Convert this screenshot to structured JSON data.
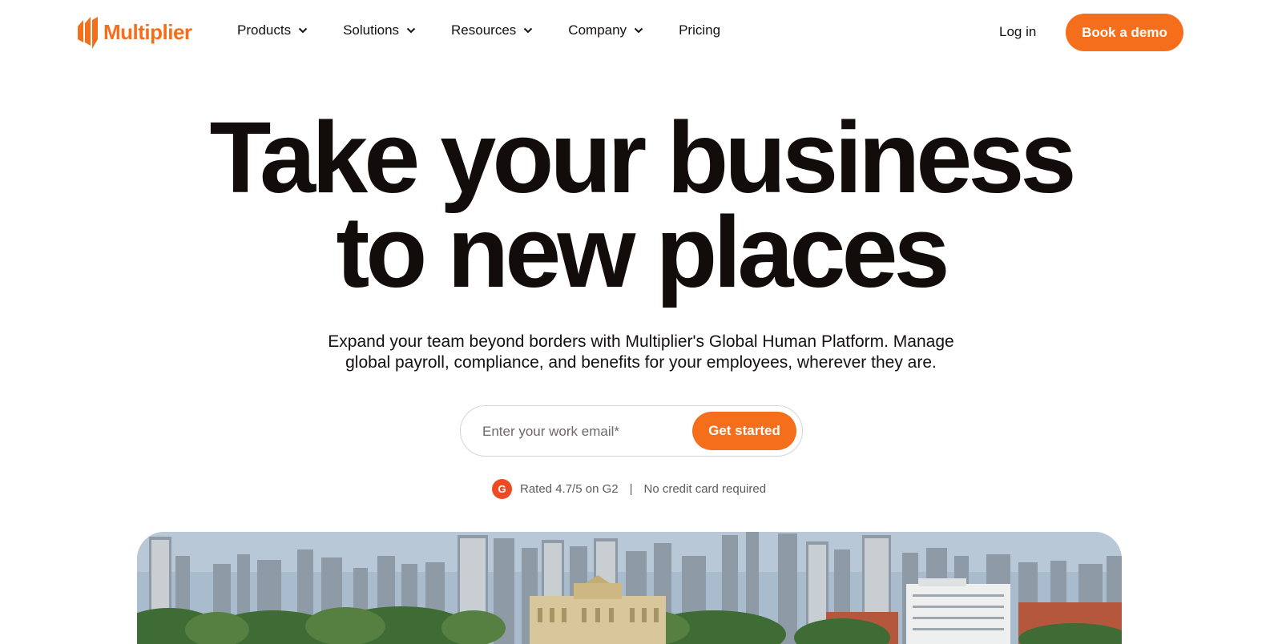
{
  "brand": {
    "name": "Multiplier",
    "logo_icon": "multiplier-logo-icon",
    "accent_color": "#f56e1b"
  },
  "nav": {
    "items": [
      {
        "label": "Products",
        "has_dropdown": true
      },
      {
        "label": "Solutions",
        "has_dropdown": true
      },
      {
        "label": "Resources",
        "has_dropdown": true
      },
      {
        "label": "Company",
        "has_dropdown": true
      },
      {
        "label": "Pricing",
        "has_dropdown": false
      }
    ],
    "login_label": "Log in",
    "demo_label": "Book a demo"
  },
  "hero": {
    "headline_line1": "Take your business",
    "headline_line2": "to new places",
    "sub_line1": "Expand your team beyond borders with Multiplier's Global Human Platform. Manage",
    "sub_line2": "global payroll, compliance, and benefits for your employees, wherever they are.",
    "email_placeholder": "Enter your work email*",
    "email_value": "",
    "cta_label": "Get started",
    "g2_badge": "G",
    "rating_text": "Rated 4.7/5 on G2",
    "separator": "|",
    "no_card_text": "No credit card required"
  },
  "media": {
    "image": "city-skyline-with-museum-photo"
  }
}
